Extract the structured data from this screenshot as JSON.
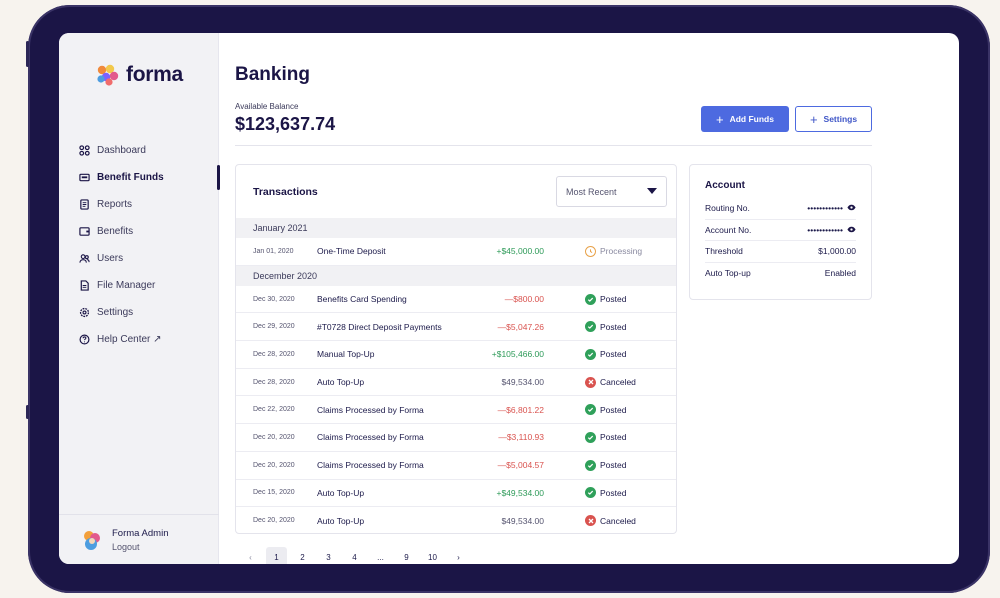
{
  "app": {
    "brand": "forma"
  },
  "sidebar": {
    "items": [
      {
        "label": "Dashboard",
        "icon": "dashboard-icon"
      },
      {
        "label": "Benefit Funds",
        "icon": "wallet-icon",
        "active": true
      },
      {
        "label": "Reports",
        "icon": "report-icon"
      },
      {
        "label": "Benefits",
        "icon": "benefits-icon"
      },
      {
        "label": "Users",
        "icon": "users-icon"
      },
      {
        "label": "File Manager",
        "icon": "file-icon"
      },
      {
        "label": "Settings",
        "icon": "gear-icon"
      },
      {
        "label": "Help Center ↗",
        "icon": "help-icon"
      }
    ],
    "user": {
      "name": "Forma Admin",
      "logout": "Logout"
    }
  },
  "page": {
    "title": "Banking",
    "balance_label": "Available Balance",
    "balance_value": "$123,637.74",
    "add_funds": "Add Funds",
    "settings": "Settings"
  },
  "transactions": {
    "title": "Transactions",
    "sort": "Most Recent",
    "groups": [
      {
        "label": "January 2021",
        "rows": [
          {
            "date": "Jan 01, 2020",
            "desc": "One-Time Deposit",
            "amount": "+$45,000.00",
            "kind": "pos",
            "status": "Processing"
          }
        ]
      },
      {
        "label": "December 2020",
        "rows": [
          {
            "date": "Dec 30, 2020",
            "desc": "Benefits Card Spending",
            "amount": "—$800.00",
            "kind": "neg",
            "status": "Posted"
          },
          {
            "date": "Dec 29, 2020",
            "desc": "#T0728 Direct Deposit Payments",
            "amount": "—$5,047.26",
            "kind": "neg",
            "status": "Posted"
          },
          {
            "date": "Dec 28, 2020",
            "desc": "Manual Top-Up",
            "amount": "+$105,466.00",
            "kind": "pos",
            "status": "Posted"
          },
          {
            "date": "Dec 28, 2020",
            "desc": "Auto Top-Up",
            "amount": "$49,534.00",
            "kind": "neu",
            "status": "Canceled"
          },
          {
            "date": "Dec 22, 2020",
            "desc": "Claims Processed by Forma",
            "amount": "—$6,801.22",
            "kind": "neg",
            "status": "Posted"
          },
          {
            "date": "Dec 20, 2020",
            "desc": "Claims Processed by Forma",
            "amount": "—$3,110.93",
            "kind": "neg",
            "status": "Posted"
          },
          {
            "date": "Dec 20, 2020",
            "desc": "Claims Processed by Forma",
            "amount": "—$5,004.57",
            "kind": "neg",
            "status": "Posted"
          },
          {
            "date": "Dec 15, 2020",
            "desc": "Auto Top-Up",
            "amount": "+$49,534.00",
            "kind": "pos",
            "status": "Posted"
          },
          {
            "date": "Dec 20, 2020",
            "desc": "Auto Top-Up",
            "amount": "$49,534.00",
            "kind": "neu",
            "status": "Canceled"
          }
        ]
      }
    ]
  },
  "account": {
    "title": "Account",
    "rows": [
      {
        "label": "Routing No.",
        "value": "••••••••••••",
        "eye": true
      },
      {
        "label": "Account No.",
        "value": "••••••••••••",
        "eye": true
      },
      {
        "label": "Threshold",
        "value": "$1,000.00"
      },
      {
        "label": "Auto Top-up",
        "value": "Enabled"
      }
    ]
  },
  "pager": {
    "prev": "‹",
    "pages": [
      "1",
      "2",
      "3",
      "4",
      "...",
      "9",
      "10"
    ],
    "current": "1",
    "next": "›"
  },
  "colors": {
    "accent": "#4d6ae0",
    "navy": "#1b1546",
    "positive": "#2d9a58",
    "negative": "#d9534f",
    "processing": "#e8a24a"
  }
}
